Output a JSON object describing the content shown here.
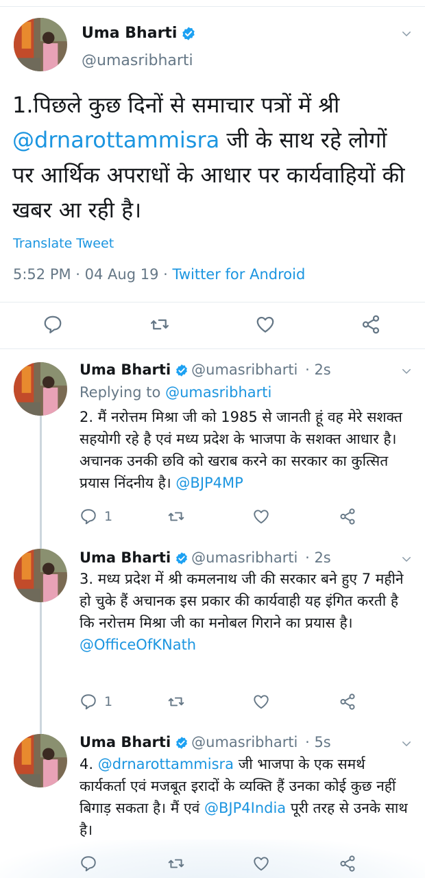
{
  "main_tweet": {
    "name": "Uma Bharti",
    "handle": "@umasribharti",
    "text_part1": "1.पिछले कुछ दिनों से समाचार पत्रों में श्री",
    "mention": "@drnarottammisra",
    "text_part2": " जी के  साथ रहे लोगों पर आर्थिक अपराधों के आधार पर कार्यवाहियों की खबर आ रही है।",
    "translate": "Translate Tweet",
    "timestamp": "5:52 PM · 04 Aug 19 · ",
    "source": "Twitter for Android"
  },
  "replies": [
    {
      "name": "Uma Bharti",
      "handle": "@umasribharti",
      "time": "· 2s",
      "replying_prefix": "Replying to ",
      "replying_to": "@umasribharti",
      "text": "2. मैं नरोत्तम मिश्रा जी को 1985 से जानती हूं वह मेरे सशक्त सहयोगी रहे है एवं मध्य प्रदेश के भाजपा  के सशक्त आधार है। अचानक उनकी छवि को खराब करने का सरकार का कुत्सित प्रयास निंदनीय है। ",
      "mention": "@BJP4MP",
      "reply_count": "1"
    },
    {
      "name": "Uma Bharti",
      "handle": "@umasribharti",
      "time": "· 2s",
      "text": "3. मध्य प्रदेश में श्री कमलनाथ जी की सरकार बने हुए 7 महीने हो चुके हैं अचानक इस प्रकार की कार्यवाही यह इंगित करती है कि नरोत्तम मिश्रा जी का मनोबल गिराने का प्रयास है।",
      "mention": "@OfficeOfKNath",
      "reply_count": "1"
    },
    {
      "name": "Uma Bharti",
      "handle": "@umasribharti",
      "time": "· 5s",
      "prefix": "4. ",
      "mention1": "@drnarottammisra",
      "text_mid": " जी भाजपा के एक समर्थ कार्यकर्ता एवं मजबूत इरादों के व्यक्ति हैं उनका कोई कुछ नहीं बिगाड़ सकता है। मैं एवं ",
      "mention2": "@BJP4India",
      "text_end": " पूरी तरह से उनके साथ है।"
    }
  ],
  "icons": [
    "reply-icon",
    "retweet-icon",
    "like-icon",
    "share-icon",
    "verified-icon",
    "chevron-down-icon"
  ],
  "colors": {
    "link": "#1b95e0",
    "muted": "#657786",
    "verified": "#1da1f2",
    "divider": "#e6ecf0"
  }
}
